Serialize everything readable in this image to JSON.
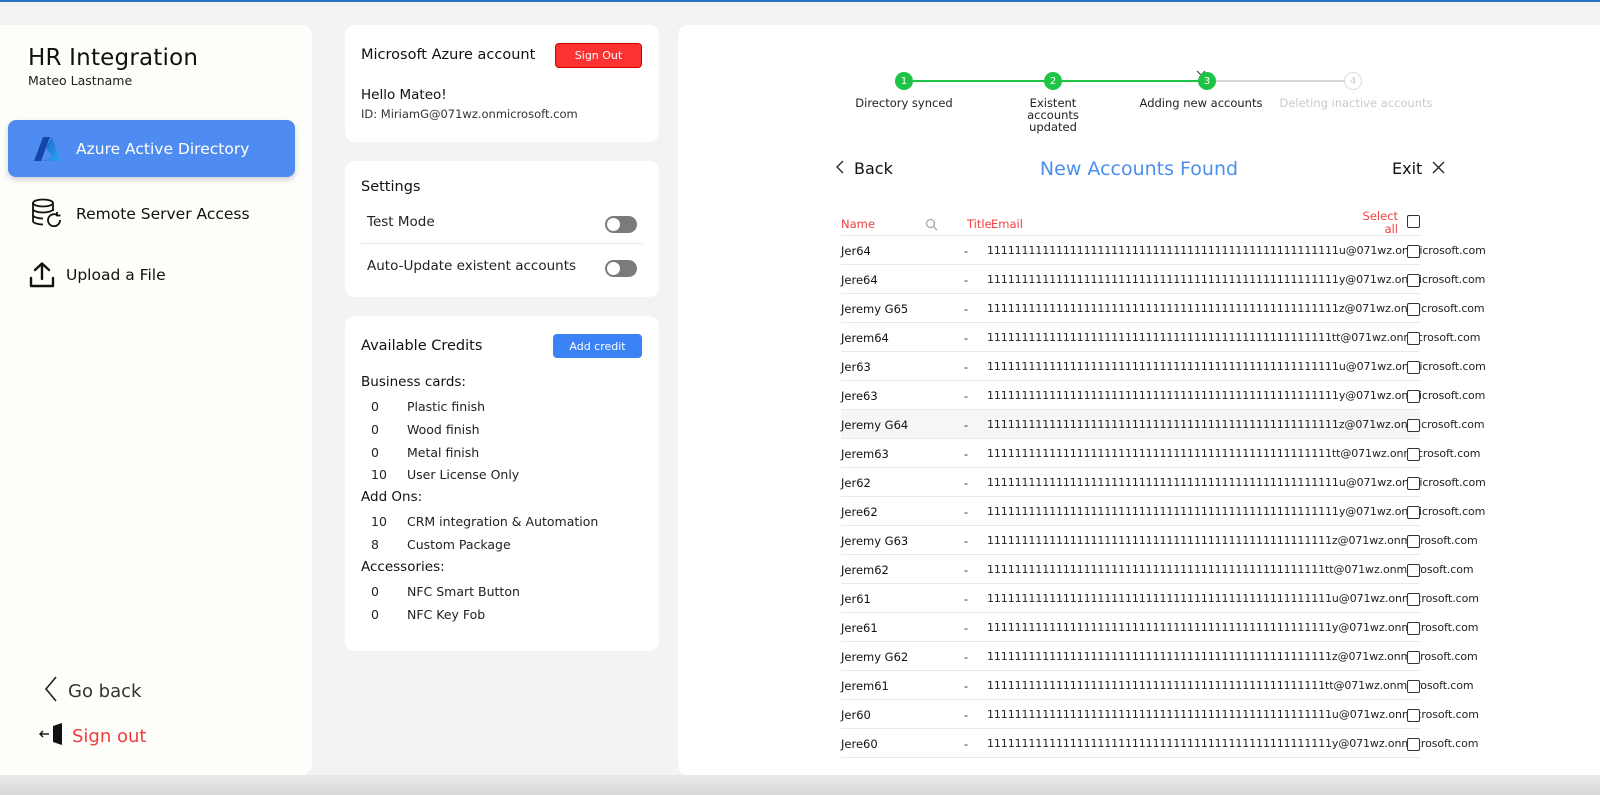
{
  "app": {
    "title": "HR Integration",
    "user": "Mateo Lastname"
  },
  "sidebar": {
    "items": [
      {
        "label": "Azure Active Directory",
        "icon": "azure-icon",
        "active": true
      },
      {
        "label": "Remote Server Access",
        "icon": "database-sync-icon",
        "active": false
      },
      {
        "label": "Upload a File",
        "icon": "upload-icon",
        "active": false
      }
    ],
    "go_back": "Go back",
    "sign_out": "Sign out"
  },
  "account": {
    "title": "Microsoft Azure account",
    "sign_out_label": "Sign Out",
    "greeting_prefix": "Hello ",
    "greeting_name": "Mateo!",
    "id_line": "ID: MiriamG@071wz.onmicrosoft.com"
  },
  "settings": {
    "title": "Settings",
    "test_mode": {
      "label": "Test Mode",
      "on": false
    },
    "auto_update": {
      "label": "Auto-Update existent accounts",
      "on": false
    }
  },
  "credits": {
    "title": "Available Credits",
    "add_label": "Add credit",
    "groups": [
      {
        "name": "Business cards:",
        "items": [
          {
            "qty": "0",
            "label": "Plastic finish"
          },
          {
            "qty": "0",
            "label": "Wood finish"
          },
          {
            "qty": "0",
            "label": "Metal finish"
          },
          {
            "qty": "10",
            "label": "User License Only"
          }
        ]
      },
      {
        "name": "Add Ons:",
        "items": [
          {
            "qty": "10",
            "label": "CRM integration & Automation"
          },
          {
            "qty": "8",
            "label": "Custom Package"
          }
        ]
      },
      {
        "name": "Accessories:",
        "items": [
          {
            "qty": "0",
            "label": "NFC Smart Button"
          },
          {
            "qty": "0",
            "label": "NFC Key Fob"
          }
        ]
      }
    ]
  },
  "stepper": {
    "steps": [
      {
        "num": "1",
        "label": "Directory synced",
        "state": "done"
      },
      {
        "num": "2",
        "label": "Existent accounts updated",
        "state": "done"
      },
      {
        "num": "3",
        "label": "Adding new accounts",
        "state": "current"
      },
      {
        "num": "4",
        "label": "Deleting inactive accounts",
        "state": "todo"
      }
    ],
    "colors": {
      "done": "#1fc446",
      "todo": "#d6d6d6"
    }
  },
  "nav": {
    "back_label": "Back",
    "heading": "New Accounts Found",
    "exit_label": "Exit"
  },
  "table": {
    "headers": {
      "name": "Name",
      "title": "Title",
      "email": "Email",
      "select_all": "Select all"
    },
    "rows": [
      {
        "name": "Jer64",
        "title": "-",
        "email": "111111111111111111111111111111111111111111111111111u@071wz.onmicrosoft.com"
      },
      {
        "name": "Jere64",
        "title": "-",
        "email": "111111111111111111111111111111111111111111111111111y@071wz.onmicrosoft.com"
      },
      {
        "name": "Jeremy G65",
        "title": "-",
        "email": "111111111111111111111111111111111111111111111111111z@071wz.onmicrosoft.com"
      },
      {
        "name": "Jerem64",
        "title": "-",
        "email": "11111111111111111111111111111111111111111111111111tt@071wz.onmicrosoft.com"
      },
      {
        "name": "Jer63",
        "title": "-",
        "email": "111111111111111111111111111111111111111111111111111u@071wz.onmicrosoft.com"
      },
      {
        "name": "Jere63",
        "title": "-",
        "email": "111111111111111111111111111111111111111111111111111y@071wz.onmicrosoft.com"
      },
      {
        "name": "Jeremy G64",
        "title": "-",
        "email": "111111111111111111111111111111111111111111111111111z@071wz.onmicrosoft.com"
      },
      {
        "name": "Jerem63",
        "title": "-",
        "email": "11111111111111111111111111111111111111111111111111tt@071wz.onmicrosoft.com"
      },
      {
        "name": "Jer62",
        "title": "-",
        "email": "111111111111111111111111111111111111111111111111111u@071wz.onmicrosoft.com"
      },
      {
        "name": "Jere62",
        "title": "-",
        "email": "111111111111111111111111111111111111111111111111111y@071wz.onmicrosoft.com"
      },
      {
        "name": "Jeremy G63",
        "title": "-",
        "email": "11111111111111111111111111111111111111111111111111z@071wz.onmicrosoft.com"
      },
      {
        "name": "Jerem62",
        "title": "-",
        "email": "1111111111111111111111111111111111111111111111111tt@071wz.onmicrosoft.com"
      },
      {
        "name": "Jer61",
        "title": "-",
        "email": "11111111111111111111111111111111111111111111111111u@071wz.onmicrosoft.com"
      },
      {
        "name": "Jere61",
        "title": "-",
        "email": "11111111111111111111111111111111111111111111111111y@071wz.onmicrosoft.com"
      },
      {
        "name": "Jeremy G62",
        "title": "-",
        "email": "11111111111111111111111111111111111111111111111111z@071wz.onmicrosoft.com"
      },
      {
        "name": "Jerem61",
        "title": "-",
        "email": "1111111111111111111111111111111111111111111111111tt@071wz.onmicrosoft.com"
      },
      {
        "name": "Jer60",
        "title": "-",
        "email": "11111111111111111111111111111111111111111111111111u@071wz.onmicrosoft.com"
      },
      {
        "name": "Jere60",
        "title": "-",
        "email": "11111111111111111111111111111111111111111111111111y@071wz.onmicrosoft.com"
      }
    ]
  },
  "colors": {
    "accent": "#4a8ff0",
    "danger": "#fb3232",
    "active_nav": "#4f8cf1",
    "header_red": "#f04141"
  }
}
